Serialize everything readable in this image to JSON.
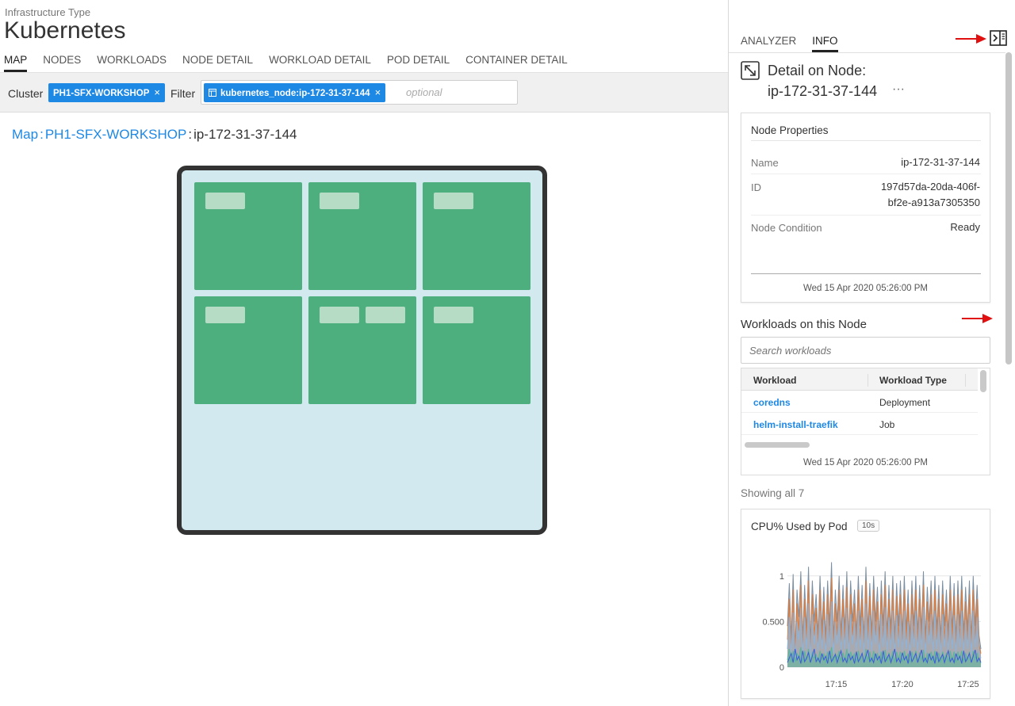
{
  "header": {
    "subtitle": "Infrastructure Type",
    "title": "Kubernetes",
    "tabs": [
      {
        "label": "MAP",
        "active": true
      },
      {
        "label": "NODES"
      },
      {
        "label": "WORKLOADS"
      },
      {
        "label": "NODE DETAIL"
      },
      {
        "label": "WORKLOAD DETAIL"
      },
      {
        "label": "POD DETAIL"
      },
      {
        "label": "CONTAINER DETAIL"
      }
    ]
  },
  "filterbar": {
    "cluster_label": "Cluster",
    "cluster_value": "PH1-SFX-WORKSHOP",
    "filter_label": "Filter",
    "filter_value": "kubernetes_node:ip-172-31-37-144",
    "filter_placeholder": "optional",
    "remove_glyph": "×"
  },
  "breadcrumb": {
    "root": "Map",
    "cluster": "PH1-SFX-WORKSHOP",
    "sep": ":",
    "current": "ip-172-31-37-144"
  },
  "node_map": {
    "pods": [
      {
        "containers": 1
      },
      {
        "containers": 1
      },
      {
        "containers": 1
      },
      {
        "containers": 1
      },
      {
        "containers": 2
      },
      {
        "containers": 1
      }
    ]
  },
  "panel": {
    "tabs": [
      {
        "label": "ANALYZER"
      },
      {
        "label": "INFO",
        "active": true
      }
    ],
    "detail_title": "Detail on Node:",
    "detail_node": "ip-172-31-37-144",
    "more_glyph": "···",
    "node_properties": {
      "title": "Node Properties",
      "name_label": "Name",
      "name_value": "ip-172-31-37-144",
      "id_label": "ID",
      "id_value_line1": "197d57da-20da-406f-",
      "id_value_line2": "bf2e-a913a7305350",
      "condition_label": "Node Condition",
      "condition_value": "Ready",
      "timestamp": "Wed 15 Apr 2020 05:26:00 PM"
    },
    "workloads": {
      "title": "Workloads on this Node",
      "search_placeholder": "Search workloads",
      "col_workload": "Workload",
      "col_type": "Workload Type",
      "rows": [
        {
          "name": "coredns",
          "type": "Deployment"
        },
        {
          "name": "helm-install-traefik",
          "type": "Job"
        }
      ],
      "timestamp": "Wed 15 Apr 2020 05:26:00 PM",
      "showing": "Showing all 7"
    },
    "cpu_chart_card": {
      "title": "CPU% Used by Pod",
      "badge": "10s"
    }
  },
  "colors": {
    "accent": "#1e88e5",
    "pod": "#4caf7d",
    "node_bg": "#d1e9ef",
    "arrow": "#e01010"
  },
  "icons": {
    "collapse_panel": "collapse-panel-icon",
    "expand": "expand-icon",
    "arrow": "red-arrow-icon"
  },
  "chart_data": {
    "type": "area",
    "title": "CPU% Used by Pod",
    "x_ticks": [
      "17:15",
      "17:20",
      "17:25"
    ],
    "y_ticks": [
      "0",
      "0.500",
      "1"
    ],
    "ylim": [
      0,
      1.25
    ],
    "grid": true,
    "series": [
      {
        "color": "#7b8fa3",
        "values": [
          0.45,
          0.92,
          0.3,
          1.02,
          0.2,
          0.85,
          0.55,
          1.05,
          0.3,
          0.9,
          0.4,
          1.1,
          0.25,
          0.95,
          0.5,
          0.8,
          0.35,
          1.0,
          0.4,
          0.88,
          0.3,
          0.95,
          0.45,
          1.15,
          0.3,
          0.85,
          0.5,
          1.0,
          0.35,
          0.9,
          0.4,
          1.05,
          0.3,
          0.95,
          0.5,
          0.85,
          0.35,
          1.0,
          0.45,
          0.9,
          0.3,
          1.1,
          0.4,
          0.92,
          0.35,
          1.0,
          0.5,
          0.88,
          0.3,
          0.95,
          0.45,
          1.05,
          0.35,
          0.9,
          0.4,
          1.0,
          0.3,
          0.92,
          0.45,
          0.95,
          0.35,
          1.0,
          0.4,
          0.85,
          0.3,
          0.95,
          0.45,
          1.0,
          0.35,
          0.9,
          0.4,
          1.05,
          0.3,
          0.88,
          0.5,
          0.95,
          0.35,
          1.0,
          0.4,
          0.9,
          0.3,
          0.95,
          0.45,
          0.85,
          0.35,
          1.0,
          0.4,
          0.92,
          0.3,
          0.95,
          0.45,
          1.0,
          0.35,
          0.88,
          0.4,
          0.95,
          0.3,
          1.0,
          0.45,
          0.9,
          0.35,
          0.2
        ]
      },
      {
        "color": "#e07b39",
        "values": [
          0.3,
          0.75,
          0.2,
          0.85,
          0.15,
          0.7,
          0.4,
          0.9,
          0.2,
          0.75,
          0.3,
          0.95,
          0.15,
          0.8,
          0.35,
          0.65,
          0.25,
          0.85,
          0.3,
          0.72,
          0.2,
          0.8,
          0.3,
          0.98,
          0.2,
          0.7,
          0.35,
          0.85,
          0.25,
          0.75,
          0.3,
          0.88,
          0.2,
          0.8,
          0.35,
          0.7,
          0.25,
          0.85,
          0.3,
          0.75,
          0.2,
          0.95,
          0.3,
          0.78,
          0.25,
          0.85,
          0.35,
          0.72,
          0.2,
          0.8,
          0.3,
          0.9,
          0.25,
          0.75,
          0.3,
          0.85,
          0.2,
          0.78,
          0.3,
          0.8,
          0.25,
          0.85,
          0.3,
          0.7,
          0.2,
          0.8,
          0.3,
          0.85,
          0.25,
          0.75,
          0.3,
          0.9,
          0.2,
          0.72,
          0.35,
          0.8,
          0.25,
          0.85,
          0.3,
          0.75,
          0.2,
          0.8,
          0.3,
          0.7,
          0.25,
          0.85,
          0.3,
          0.78,
          0.2,
          0.8,
          0.3,
          0.85,
          0.25,
          0.72,
          0.3,
          0.8,
          0.2,
          0.85,
          0.3,
          0.75,
          0.25,
          0.15
        ]
      },
      {
        "color": "#8cb4dc",
        "values": [
          0.2,
          0.55,
          0.15,
          0.6,
          0.1,
          0.5,
          0.3,
          0.65,
          0.15,
          0.55,
          0.2,
          0.7,
          0.1,
          0.58,
          0.25,
          0.48,
          0.18,
          0.62,
          0.2,
          0.52,
          0.15,
          0.58,
          0.22,
          0.72,
          0.15,
          0.5,
          0.25,
          0.62,
          0.18,
          0.55,
          0.2,
          0.65,
          0.15,
          0.58,
          0.25,
          0.5,
          0.18,
          0.62,
          0.2,
          0.55,
          0.15,
          0.7,
          0.2,
          0.57,
          0.18,
          0.62,
          0.25,
          0.52,
          0.15,
          0.58,
          0.22,
          0.66,
          0.18,
          0.55,
          0.2,
          0.62,
          0.15,
          0.57,
          0.22,
          0.58,
          0.18,
          0.62,
          0.2,
          0.5,
          0.15,
          0.58,
          0.22,
          0.62,
          0.18,
          0.55,
          0.2,
          0.66,
          0.15,
          0.52,
          0.25,
          0.58,
          0.18,
          0.62,
          0.2,
          0.55,
          0.15,
          0.58,
          0.22,
          0.5,
          0.18,
          0.62,
          0.2,
          0.57,
          0.15,
          0.58,
          0.22,
          0.62,
          0.18,
          0.52,
          0.2,
          0.58,
          0.15,
          0.62,
          0.22,
          0.55,
          0.18,
          0.1
        ]
      },
      {
        "color": "#5ab89a",
        "values": [
          0.08,
          0.2,
          0.05,
          0.18,
          0.06,
          0.15,
          0.1,
          0.22,
          0.05,
          0.18,
          0.08,
          0.2,
          0.05,
          0.16,
          0.1,
          0.14,
          0.06,
          0.18,
          0.08,
          0.15,
          0.05,
          0.17,
          0.09,
          0.22,
          0.06,
          0.15,
          0.1,
          0.18,
          0.07,
          0.16,
          0.08,
          0.2,
          0.05,
          0.17,
          0.1,
          0.15,
          0.06,
          0.18,
          0.08,
          0.16,
          0.05,
          0.2,
          0.08,
          0.17,
          0.06,
          0.18,
          0.1,
          0.15,
          0.05,
          0.17,
          0.09,
          0.19,
          0.06,
          0.16,
          0.08,
          0.18,
          0.05,
          0.17,
          0.09,
          0.17,
          0.06,
          0.18,
          0.08,
          0.15,
          0.05,
          0.17,
          0.09,
          0.18,
          0.06,
          0.16,
          0.08,
          0.19,
          0.05,
          0.15,
          0.1,
          0.17,
          0.06,
          0.18,
          0.08,
          0.16,
          0.05,
          0.17,
          0.09,
          0.15,
          0.06,
          0.18,
          0.08,
          0.17,
          0.05,
          0.17,
          0.09,
          0.18,
          0.06,
          0.15,
          0.08,
          0.17,
          0.05,
          0.18,
          0.09,
          0.16,
          0.06,
          0.04
        ]
      },
      {
        "color": "#3b5bdb",
        "values": [
          0.05,
          0.1,
          0.15,
          0.05,
          0.2,
          0.08,
          0.12,
          0.04,
          0.18,
          0.06,
          0.1,
          0.16,
          0.05,
          0.12,
          0.2,
          0.06,
          0.1,
          0.05,
          0.15,
          0.08,
          0.12,
          0.04,
          0.18,
          0.06,
          0.1,
          0.14,
          0.05,
          0.12,
          0.18,
          0.06,
          0.1,
          0.05,
          0.15,
          0.08,
          0.12,
          0.04,
          0.17,
          0.06,
          0.1,
          0.15,
          0.05,
          0.12,
          0.19,
          0.06,
          0.1,
          0.05,
          0.15,
          0.08,
          0.12,
          0.04,
          0.18,
          0.06,
          0.1,
          0.14,
          0.05,
          0.12,
          0.2,
          0.06,
          0.1,
          0.05,
          0.16,
          0.08,
          0.12,
          0.04,
          0.18,
          0.06,
          0.1,
          0.15,
          0.05,
          0.12,
          0.19,
          0.06,
          0.1,
          0.05,
          0.15,
          0.08,
          0.12,
          0.04,
          0.17,
          0.06,
          0.1,
          0.14,
          0.05,
          0.12,
          0.18,
          0.06,
          0.1,
          0.05,
          0.15,
          0.08,
          0.12,
          0.04,
          0.18,
          0.06,
          0.1,
          0.15,
          0.05,
          0.12,
          0.19,
          0.06,
          0.1,
          0.05
        ]
      }
    ]
  }
}
